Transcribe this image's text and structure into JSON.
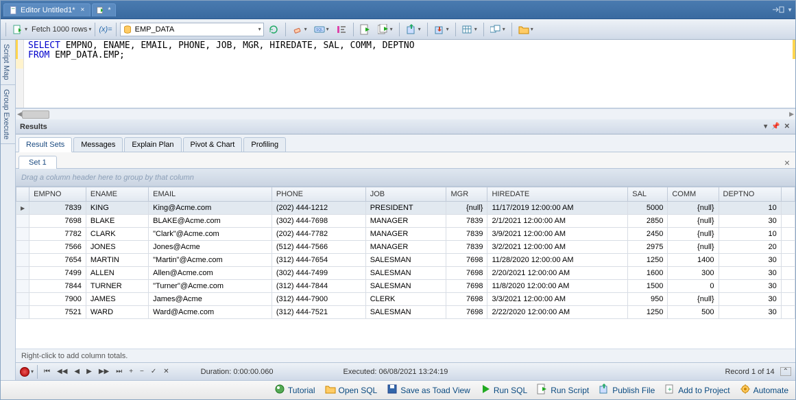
{
  "title_tab": "Editor Untitled1*",
  "toolbar": {
    "fetch_label": "Fetch 1000 rows",
    "db_name": "EMP_DATA"
  },
  "left_rail": [
    "Script Map",
    "Group Execute"
  ],
  "sql": {
    "line1_kw": "SELECT",
    "line1_rest": " EMPNO, ENAME, EMAIL, PHONE, JOB, MGR, HIREDATE, SAL, COMM, DEPTNO",
    "line2_kw": "FROM",
    "line2_rest": " EMP_DATA.EMP;"
  },
  "results": {
    "header": "Results",
    "tabs": [
      "Result Sets",
      "Messages",
      "Explain Plan",
      "Pivot & Chart",
      "Profiling"
    ],
    "set_label": "Set 1",
    "group_hint": "Drag a column header here to group by that column",
    "columns": [
      "EMPNO",
      "ENAME",
      "EMAIL",
      "PHONE",
      "JOB",
      "MGR",
      "HIREDATE",
      "SAL",
      "COMM",
      "DEPTNO"
    ],
    "rows": [
      {
        "EMPNO": 7839,
        "ENAME": "KING",
        "EMAIL": "King@Acme.com",
        "PHONE": "(202) 444-1212",
        "JOB": "PRESIDENT",
        "MGR": "{null}",
        "HIREDATE": "11/17/2019 12:00:00 AM",
        "SAL": 5000,
        "COMM": "{null}",
        "DEPTNO": 10
      },
      {
        "EMPNO": 7698,
        "ENAME": "BLAKE",
        "EMAIL": "BLAKE@Acme.com",
        "PHONE": "(302) 444-7698",
        "JOB": "MANAGER",
        "MGR": 7839,
        "HIREDATE": "2/1/2021 12:00:00 AM",
        "SAL": 2850,
        "COMM": "{null}",
        "DEPTNO": 30
      },
      {
        "EMPNO": 7782,
        "ENAME": "CLARK",
        "EMAIL": "\"Clark\"@Acme.com",
        "PHONE": "(202) 444-7782",
        "JOB": "MANAGER",
        "MGR": 7839,
        "HIREDATE": "3/9/2021 12:00:00 AM",
        "SAL": 2450,
        "COMM": "{null}",
        "DEPTNO": 10
      },
      {
        "EMPNO": 7566,
        "ENAME": "JONES",
        "EMAIL": "Jones@Acme",
        "PHONE": "(512) 444-7566",
        "JOB": "MANAGER",
        "MGR": 7839,
        "HIREDATE": "3/2/2021 12:00:00 AM",
        "SAL": 2975,
        "COMM": "{null}",
        "DEPTNO": 20
      },
      {
        "EMPNO": 7654,
        "ENAME": "MARTIN",
        "EMAIL": "\"Martin\"@Acme.com",
        "PHONE": "(312) 444-7654",
        "JOB": "SALESMAN",
        "MGR": 7698,
        "HIREDATE": "11/28/2020 12:00:00 AM",
        "SAL": 1250,
        "COMM": 1400,
        "DEPTNO": 30
      },
      {
        "EMPNO": 7499,
        "ENAME": "ALLEN",
        "EMAIL": "Allen@Acme.com",
        "PHONE": "(302) 444-7499",
        "JOB": "SALESMAN",
        "MGR": 7698,
        "HIREDATE": "2/20/2021 12:00:00 AM",
        "SAL": 1600,
        "COMM": 300,
        "DEPTNO": 30
      },
      {
        "EMPNO": 7844,
        "ENAME": "TURNER",
        "EMAIL": "\"Turner\"@Acme.com",
        "PHONE": "(312) 444-7844",
        "JOB": "SALESMAN",
        "MGR": 7698,
        "HIREDATE": "11/8/2020 12:00:00 AM",
        "SAL": 1500,
        "COMM": 0,
        "DEPTNO": 30
      },
      {
        "EMPNO": 7900,
        "ENAME": "JAMES",
        "EMAIL": "James@Acme",
        "PHONE": "(312) 444-7900",
        "JOB": "CLERK",
        "MGR": 7698,
        "HIREDATE": "3/3/2021 12:00:00 AM",
        "SAL": 950,
        "COMM": "{null}",
        "DEPTNO": 30
      },
      {
        "EMPNO": 7521,
        "ENAME": "WARD",
        "EMAIL": "Ward@Acme.com",
        "PHONE": "(312) 444-7521",
        "JOB": "SALESMAN",
        "MGR": 7698,
        "HIREDATE": "2/22/2020 12:00:00 AM",
        "SAL": 1250,
        "COMM": 500,
        "DEPTNO": 30
      }
    ],
    "footer_hint": "Right-click to add column totals.",
    "duration": "Duration: 0:00:00.060",
    "executed": "Executed: 06/08/2021 13:24:19",
    "record": "Record 1 of 14"
  },
  "bottom": [
    {
      "icon": "tutorial",
      "label": "Tutorial"
    },
    {
      "icon": "open",
      "label": "Open SQL"
    },
    {
      "icon": "save",
      "label": "Save as Toad View"
    },
    {
      "icon": "run",
      "label": "Run SQL"
    },
    {
      "icon": "runscript",
      "label": "Run Script"
    },
    {
      "icon": "publish",
      "label": "Publish File"
    },
    {
      "icon": "addproj",
      "label": "Add to Project"
    },
    {
      "icon": "automate",
      "label": "Automate"
    }
  ]
}
